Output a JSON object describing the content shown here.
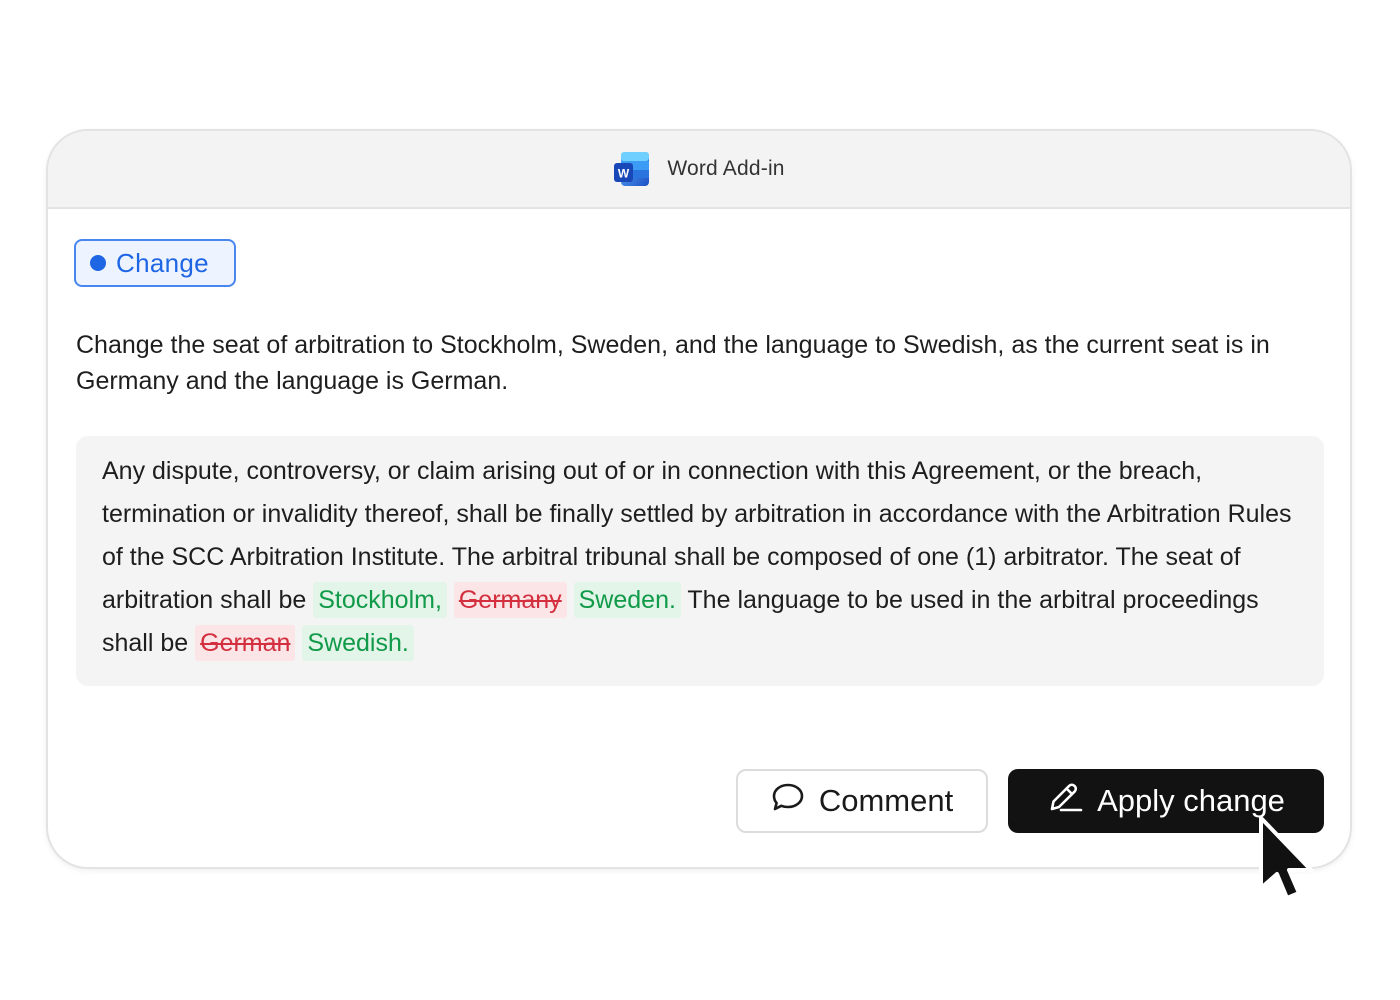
{
  "window": {
    "title": "Word Add-in",
    "icon": "word-icon"
  },
  "chip": {
    "label": "Change",
    "color": "#1f66e5"
  },
  "instruction": "Change the seat of arbitration to Stockholm, Sweden, and the language to Swedish, as the current seat is in Germany and the language is German.",
  "clause": {
    "text_1": "Any dispute, controversy, or claim arising out of or in connection with this Agreement, or the breach, termination or invalidity thereof, shall be finally settled by arbitration in accordance with the Arbitration Rules of the SCC Arbitration Institute. The arbitral tribunal shall be composed of one (1) arbitrator. The seat of arbitration shall be ",
    "insert_1": "Stockholm,",
    "delete_1": "Germany",
    "insert_2": "Sweden.",
    "text_2": " The language to be used in the arbitral proceedings  shall be ",
    "delete_2": "German",
    "insert_3": "Swedish.",
    "insert_color": "#119a4a",
    "delete_color": "#d32f3f"
  },
  "actions": {
    "comment_label": "Comment",
    "comment_icon": "speech-bubble-icon",
    "apply_label": "Apply change",
    "apply_icon": "pencil-icon"
  }
}
